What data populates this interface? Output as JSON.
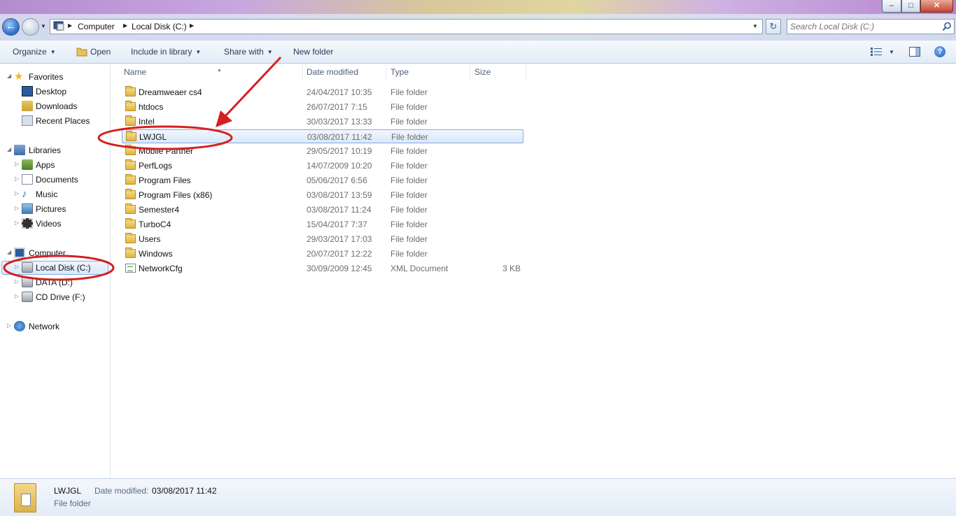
{
  "window": {
    "minimize_symbol": "–",
    "maximize_symbol": "□",
    "close_symbol": "✕"
  },
  "address": {
    "crumbs": [
      "Computer",
      "Local Disk (C:)"
    ],
    "search_placeholder": "Search Local Disk (C:)"
  },
  "toolbar": {
    "organize": "Organize",
    "open": "Open",
    "include_in_library": "Include in library",
    "share_with": "Share with",
    "new_folder": "New folder",
    "help": "?"
  },
  "nav": {
    "favorites": "Favorites",
    "desktop": "Desktop",
    "downloads": "Downloads",
    "recent_places": "Recent Places",
    "libraries": "Libraries",
    "apps": "Apps",
    "documents": "Documents",
    "music": "Music",
    "pictures": "Pictures",
    "videos": "Videos",
    "computer": "Computer",
    "local_disk": "Local Disk (C:)",
    "data_drive": "DATA (D:)",
    "cd_drive": "CD Drive (F:)",
    "network": "Network"
  },
  "columns": {
    "name": "Name",
    "date_modified": "Date modified",
    "type": "Type",
    "size": "Size"
  },
  "files": [
    {
      "name": "Dreamweaer cs4",
      "date": "24/04/2017 10:35",
      "type": "File folder",
      "size": ""
    },
    {
      "name": "htdocs",
      "date": "26/07/2017 7:15",
      "type": "File folder",
      "size": ""
    },
    {
      "name": "Intel",
      "date": "30/03/2017 13:33",
      "type": "File folder",
      "size": ""
    },
    {
      "name": "LWJGL",
      "date": "03/08/2017 11:42",
      "type": "File folder",
      "size": ""
    },
    {
      "name": "Mobile Partner",
      "date": "29/05/2017 10:19",
      "type": "File folder",
      "size": ""
    },
    {
      "name": "PerfLogs",
      "date": "14/07/2009 10:20",
      "type": "File folder",
      "size": ""
    },
    {
      "name": "Program Files",
      "date": "05/06/2017 6:56",
      "type": "File folder",
      "size": ""
    },
    {
      "name": "Program Files (x86)",
      "date": "03/08/2017 13:59",
      "type": "File folder",
      "size": ""
    },
    {
      "name": "Semester4",
      "date": "03/08/2017 11:24",
      "type": "File folder",
      "size": ""
    },
    {
      "name": "TurboC4",
      "date": "15/04/2017 7:37",
      "type": "File folder",
      "size": ""
    },
    {
      "name": "Users",
      "date": "29/03/2017 17:03",
      "type": "File folder",
      "size": ""
    },
    {
      "name": "Windows",
      "date": "20/07/2017 12:22",
      "type": "File folder",
      "size": ""
    },
    {
      "name": "NetworkCfg",
      "date": "30/09/2009 12:45",
      "type": "XML Document",
      "size": "3 KB"
    }
  ],
  "details": {
    "name": "LWJGL",
    "date_label": "Date modified:",
    "date_value": "03/08/2017 11:42",
    "type": "File folder"
  },
  "annotation_color": "#d42020"
}
